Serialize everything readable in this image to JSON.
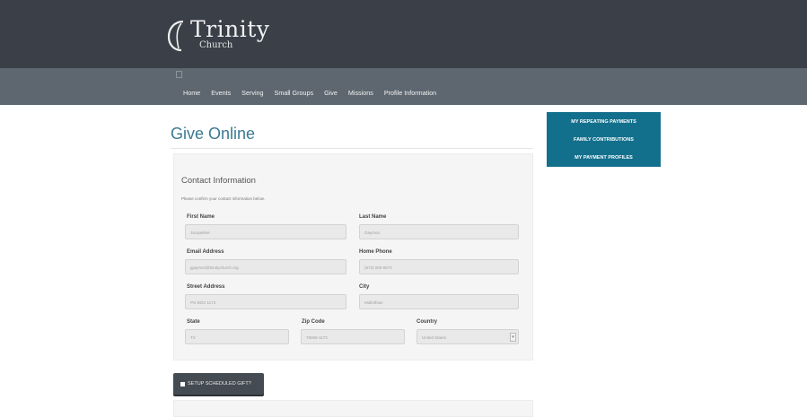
{
  "logo": {
    "name": "Trinity",
    "sub": "Church"
  },
  "nav": {
    "items": [
      "Home",
      "Events",
      "Serving",
      "Small Groups",
      "Give",
      "Missions",
      "Profile Information"
    ]
  },
  "page": {
    "title": "Give Online"
  },
  "contact": {
    "section_title": "Contact Information",
    "description": "Please confirm your contact information below.",
    "fields": {
      "first_name": {
        "label": "First Name",
        "value": "Jacqueline"
      },
      "last_name": {
        "label": "Last Name",
        "value": "Gaymon"
      },
      "email": {
        "label": "Email Address",
        "value": "jgaymon@trinitychurch.org"
      },
      "home_phone": {
        "label": "Home Phone",
        "value": "(972) 000-0674"
      },
      "street": {
        "label": "Street Address",
        "value": "PO BOX 1173"
      },
      "city": {
        "label": "City",
        "value": "Midlothian"
      },
      "state": {
        "label": "State",
        "value": "TX"
      },
      "zip": {
        "label": "Zip Code",
        "value": "76065-1173"
      },
      "country": {
        "label": "Country",
        "value": "United States"
      }
    }
  },
  "sidebar": {
    "links": [
      "MY REPEATING PAYMENTS",
      "FAMILY CONTRIBUTIONS",
      "MY PAYMENT PROFILES"
    ]
  },
  "schedule": {
    "label": "SETUP SCHEDULED GIFT?"
  },
  "icons": {
    "logo": "trinity-logo-mark",
    "nav": "small-page-icon",
    "select": "chevron-down-icon",
    "checkbox": "checkbox-icon"
  },
  "colors": {
    "header": "#3a3f48",
    "navbar": "#5e6770",
    "title": "#3c7a93",
    "side_panel": "#13708d",
    "button": "#444b53"
  }
}
